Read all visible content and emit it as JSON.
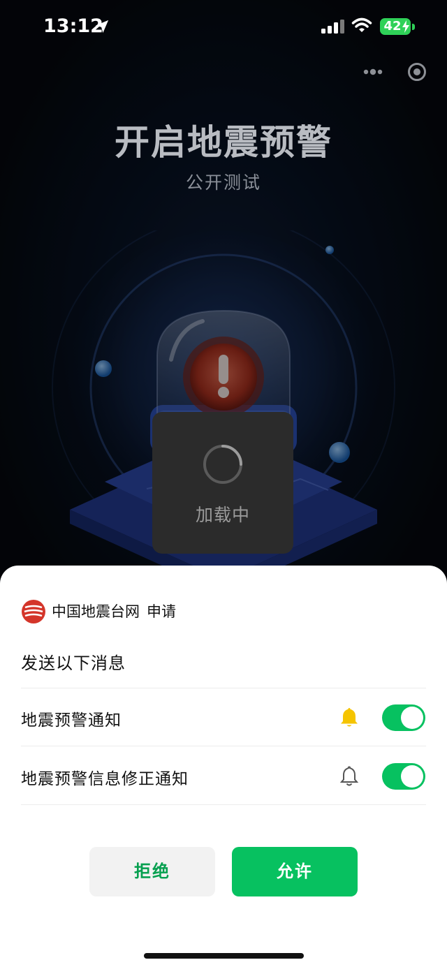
{
  "status_bar": {
    "time": "13:12",
    "battery": "42"
  },
  "capsule": {
    "more_icon": "more-dots-icon",
    "close_icon": "target-close-icon"
  },
  "hero": {
    "title": "开启地震预警",
    "subtitle": "公开测试"
  },
  "toast": {
    "text": "加载中"
  },
  "sheet": {
    "app_name": "中国地震台网",
    "action": "申请",
    "heading": "发送以下消息",
    "options": [
      {
        "label": "地震预警通知",
        "bell_icon": "bell-filled-icon",
        "enabled": true
      },
      {
        "label": "地震预警信息修正通知",
        "bell_icon": "bell-outline-icon",
        "enabled": true
      }
    ],
    "reject_label": "拒绝",
    "allow_label": "允许"
  },
  "colors": {
    "accent": "#07c160",
    "bell_active": "#f5c400",
    "toast_bg": "#2b2b2b",
    "battery": "#2fd158"
  }
}
